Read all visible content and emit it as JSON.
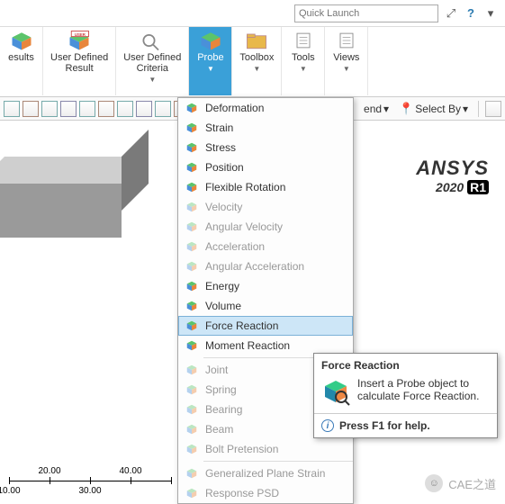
{
  "top": {
    "quick_launch_placeholder": "Quick Launch",
    "help_icon": "?"
  },
  "ribbon": {
    "items": [
      {
        "label": "esults",
        "has_arrow": false,
        "icon": "cube"
      },
      {
        "label": "User Defined\nResult",
        "has_arrow": false,
        "icon": "cube-user",
        "badge": "USER"
      },
      {
        "label": "User Defined\nCriteria",
        "has_arrow": true,
        "icon": "criteria"
      },
      {
        "label": "Probe",
        "has_arrow": true,
        "icon": "cube",
        "selected": true
      },
      {
        "label": "Toolbox",
        "has_arrow": true,
        "icon": "folder"
      },
      {
        "label": "Tools",
        "has_arrow": true,
        "icon": "page"
      },
      {
        "label": "Views",
        "has_arrow": true,
        "icon": "page"
      }
    ]
  },
  "toolbar": {
    "end_label": "end",
    "select_by_label": "Select By"
  },
  "dropdown": {
    "items": [
      {
        "label": "Deformation",
        "disabled": false
      },
      {
        "label": "Strain",
        "disabled": false
      },
      {
        "label": "Stress",
        "disabled": false
      },
      {
        "label": "Position",
        "disabled": false
      },
      {
        "label": "Flexible Rotation",
        "disabled": false
      },
      {
        "label": "Velocity",
        "disabled": true
      },
      {
        "label": "Angular Velocity",
        "disabled": true
      },
      {
        "label": "Acceleration",
        "disabled": true
      },
      {
        "label": "Angular Acceleration",
        "disabled": true
      },
      {
        "label": "Energy",
        "disabled": false
      },
      {
        "label": "Volume",
        "disabled": false
      },
      {
        "label": "Force Reaction",
        "disabled": false,
        "hover": true
      },
      {
        "label": "Moment Reaction",
        "disabled": false
      },
      {
        "sep": true
      },
      {
        "label": "Joint",
        "disabled": true
      },
      {
        "label": "Spring",
        "disabled": true
      },
      {
        "label": "Bearing",
        "disabled": true
      },
      {
        "label": "Beam",
        "disabled": true
      },
      {
        "label": "Bolt Pretension",
        "disabled": true
      },
      {
        "sep": true
      },
      {
        "label": "Generalized Plane Strain",
        "disabled": true
      },
      {
        "label": "Response PSD",
        "disabled": true
      }
    ]
  },
  "tooltip": {
    "title": "Force Reaction",
    "body": "Insert a Probe object to calculate Force Reaction.",
    "help": "Press F1 for help."
  },
  "brand": {
    "name": "ANSYS",
    "version": "2020 ",
    "release": "R1"
  },
  "ruler": {
    "t1": "20.00",
    "t2": "40.00",
    "b1": "10.00",
    "b2": "30.00"
  },
  "watermark": {
    "icon": "☺",
    "text": "CAE之道"
  }
}
